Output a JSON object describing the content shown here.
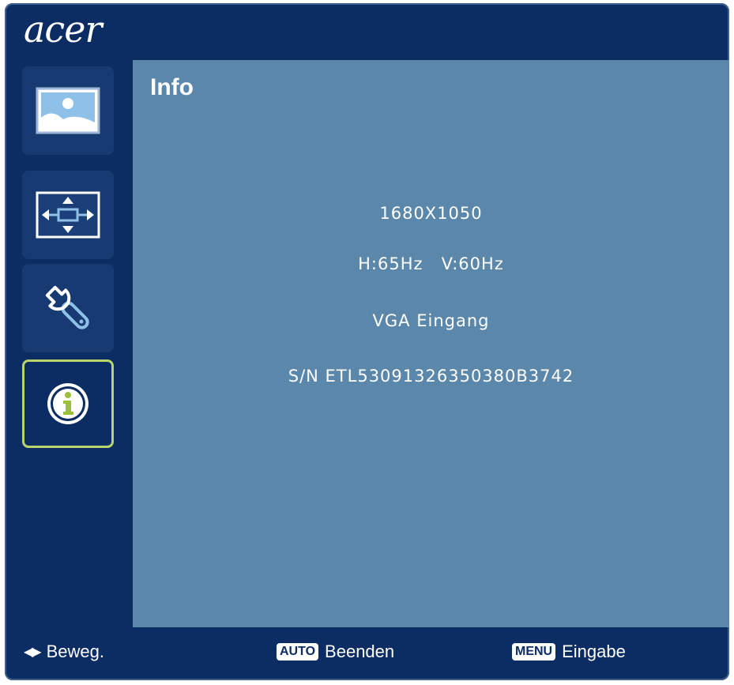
{
  "brand": "acer",
  "sidebar": {
    "items": [
      {
        "icon": "picture-icon",
        "active": false
      },
      {
        "icon": "position-icon",
        "active": false
      },
      {
        "icon": "settings-wrench-icon",
        "active": false
      },
      {
        "icon": "info-icon",
        "active": true
      }
    ]
  },
  "content": {
    "title": "Info",
    "resolution": "1680X1050",
    "frequency": "H:65Hz   V:60Hz",
    "input": "VGA Eingang",
    "serial": "S/N ETL53091326350380B3742"
  },
  "footer": {
    "move_label": "Beweg.",
    "auto_key": "AUTO",
    "auto_label": "Beenden",
    "menu_key": "MENU",
    "menu_label": "Eingabe"
  },
  "colors": {
    "frame": "#0c2d63",
    "panel": "#5a87aa",
    "active_border": "#b9d36a",
    "icon_blue": "#8fc1e8"
  }
}
